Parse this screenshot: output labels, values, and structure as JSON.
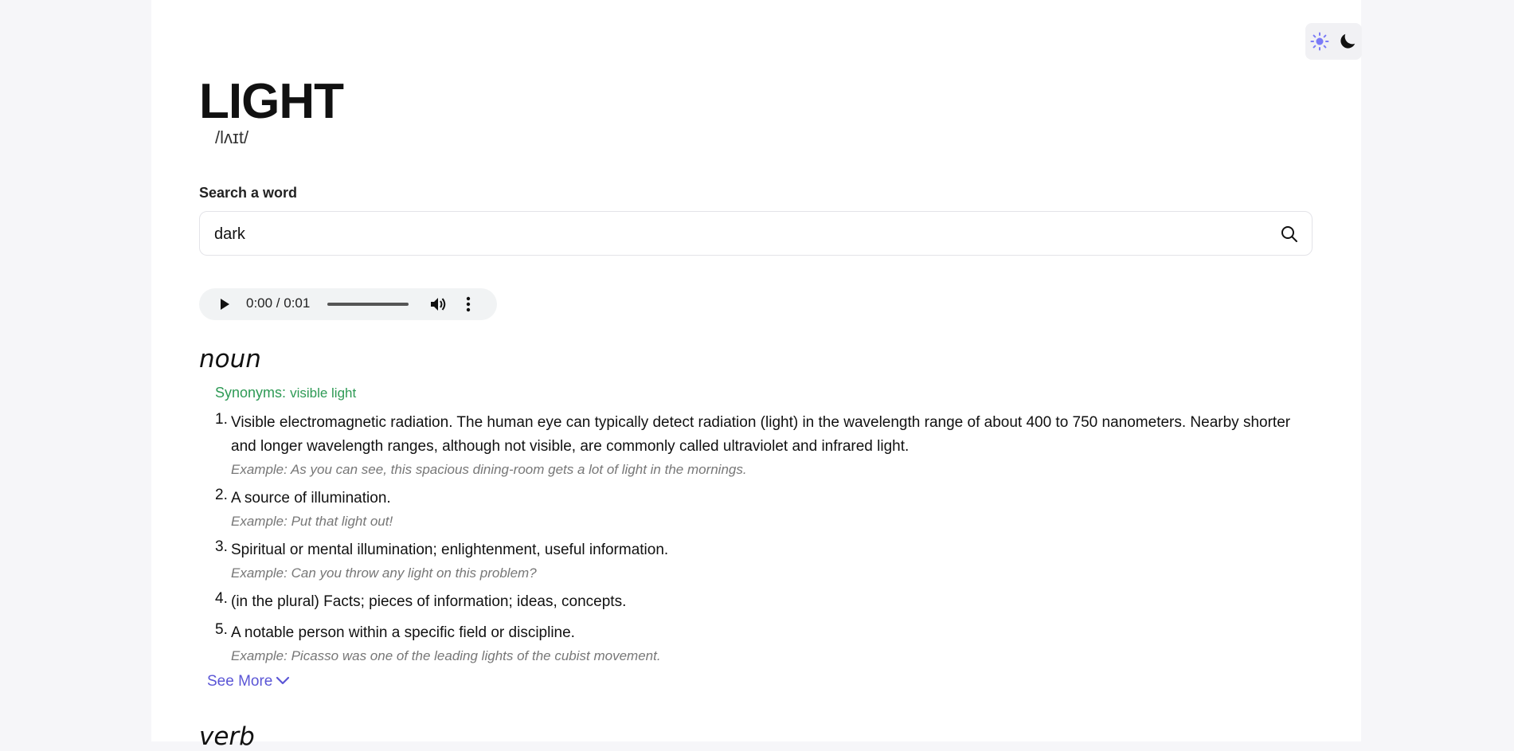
{
  "theme": {
    "light_icon": "sun-icon",
    "dark_icon": "moon-icon",
    "accent": "#7b7bf7"
  },
  "word": "LIGHT",
  "phonetic": "/lʌɪt/",
  "search": {
    "label": "Search a word",
    "value": "dark",
    "icon": "search-icon"
  },
  "audio": {
    "time": "0:00 / 0:01"
  },
  "noun": {
    "label": "noun",
    "synonyms_label": "Synonyms:",
    "synonyms_value": "visible light",
    "definitions": [
      {
        "num": "1.",
        "text": "Visible electromagnetic radiation. The human eye can typically detect radiation (light) in the wavelength range of about 400 to 750 nanometers. Nearby shorter and longer wavelength ranges, although not visible, are commonly called ultraviolet and infrared light.",
        "example": "Example: As you can see, this spacious dining-room gets a lot of light in the mornings."
      },
      {
        "num": "2.",
        "text": "A source of illumination.",
        "example": "Example: Put that light out!"
      },
      {
        "num": "3.",
        "text": "Spiritual or mental illumination; enlightenment, useful information.",
        "example": "Example: Can you throw any light on this problem?"
      },
      {
        "num": "4.",
        "text": "(in the plural) Facts; pieces of information; ideas, concepts.",
        "example": ""
      },
      {
        "num": "5.",
        "text": "A notable person within a specific field or discipline.",
        "example": "Example: Picasso was one of the leading lights of the cubist movement."
      }
    ],
    "see_more": "See More"
  },
  "verb": {
    "label": "verb"
  },
  "colors": {
    "synonym": "#2e9a55",
    "link": "#5b56d6"
  }
}
